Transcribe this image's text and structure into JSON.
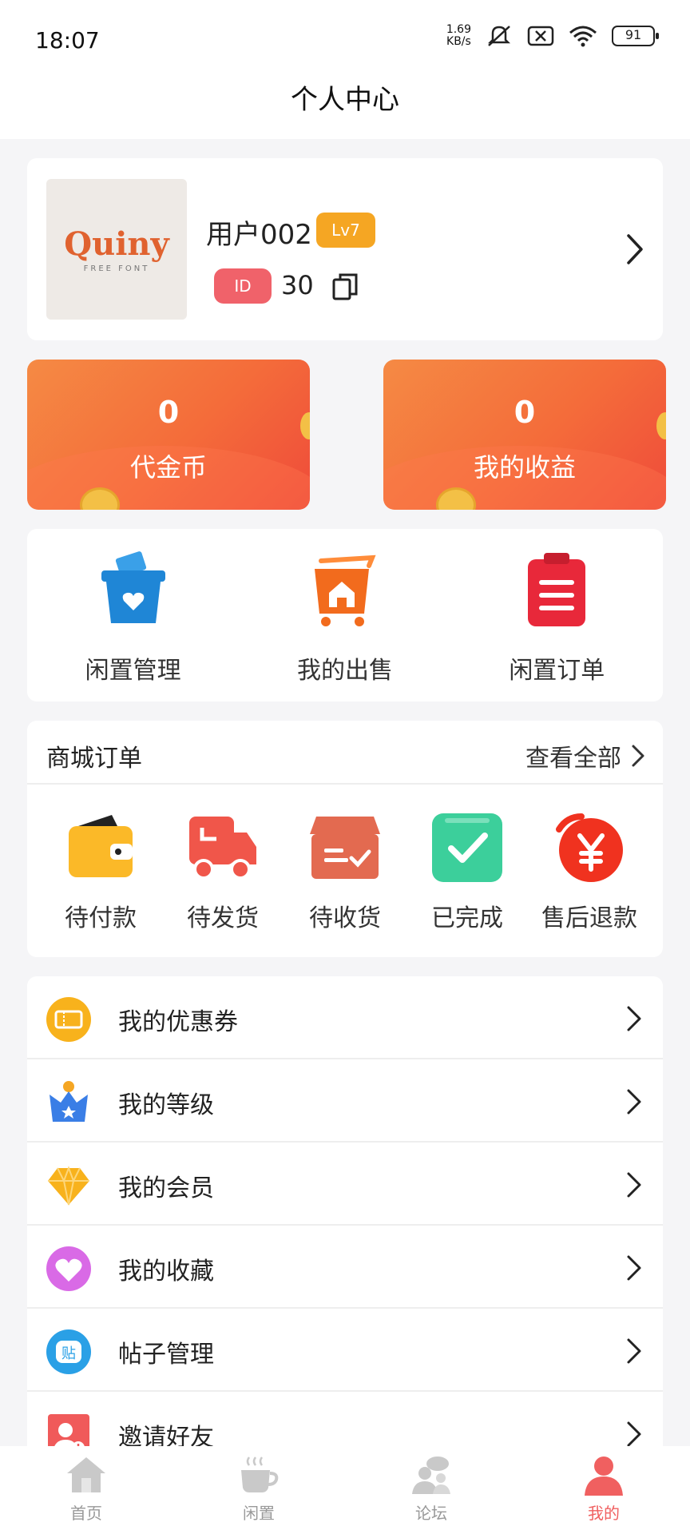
{
  "status": {
    "time": "18:07",
    "net_speed_value": "1.69",
    "net_speed_unit": "KB/s",
    "battery": "91"
  },
  "header": {
    "title": "个人中心"
  },
  "profile": {
    "avatar_text": "Quiny",
    "avatar_subtext": "FREE FONT",
    "username": "用户002",
    "level": "Lv7",
    "id_label": "ID",
    "id_value": "30"
  },
  "wallet": [
    {
      "value": "0",
      "label": "代金币"
    },
    {
      "value": "0",
      "label": "我的收益"
    }
  ],
  "quick_actions": [
    {
      "label": "闲置管理",
      "icon": "basket-heart-icon"
    },
    {
      "label": "我的出售",
      "icon": "cart-shop-icon"
    },
    {
      "label": "闲置订单",
      "icon": "clipboard-list-icon"
    }
  ],
  "mall_orders": {
    "title": "商城订单",
    "view_all": "查看全部",
    "items": [
      {
        "label": "待付款",
        "icon": "wallet-icon"
      },
      {
        "label": "待发货",
        "icon": "truck-icon"
      },
      {
        "label": "待收货",
        "icon": "box-check-icon"
      },
      {
        "label": "已完成",
        "icon": "check-icon"
      },
      {
        "label": "售后退款",
        "icon": "yen-refund-icon"
      }
    ]
  },
  "menu": [
    {
      "label": "我的优惠券",
      "icon": "coupon-icon"
    },
    {
      "label": "我的等级",
      "icon": "crown-icon"
    },
    {
      "label": "我的会员",
      "icon": "diamond-icon"
    },
    {
      "label": "我的收藏",
      "icon": "heart-icon"
    },
    {
      "label": "帖子管理",
      "icon": "post-icon",
      "icon_text": "贴"
    },
    {
      "label": "邀请好友",
      "icon": "invite-friend-icon"
    }
  ],
  "tabs": [
    {
      "label": "首页",
      "icon": "home-icon"
    },
    {
      "label": "闲置",
      "icon": "cup-icon"
    },
    {
      "label": "论坛",
      "icon": "forum-icon"
    },
    {
      "label": "我的",
      "icon": "user-icon",
      "active": true
    }
  ],
  "colors": {
    "accent": "#f06060",
    "wallet_gradient_start": "#f58a44",
    "wallet_gradient_end": "#ef4b3a",
    "level_badge": "#f5a623",
    "id_badge": "#f0626a"
  }
}
